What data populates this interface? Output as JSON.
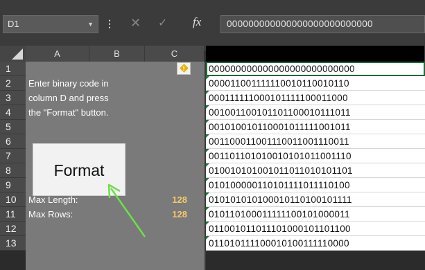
{
  "formula_bar": {
    "cell_ref": "D1",
    "cancel_icon": "close-icon",
    "enter_icon": "check-icon",
    "fx_label": "fx",
    "content": "000000000000000000000000000"
  },
  "columns": [
    "A",
    "B",
    "C",
    "D"
  ],
  "rows": [
    "1",
    "2",
    "3",
    "4",
    "5",
    "6",
    "7",
    "8",
    "9",
    "10",
    "11",
    "12",
    "13"
  ],
  "instructions": [
    "Enter binary code in",
    "column D and press",
    "the \"Format\" button."
  ],
  "format_button": {
    "label": "Format"
  },
  "settings": {
    "max_length_label": "Max Length:",
    "max_length_value": "128",
    "max_rows_label": "Max Rows:",
    "max_rows_value": "128"
  },
  "column_d": [
    "000000000000000000000000000",
    "000011001111110010110010110",
    "000111111000101111100011000",
    "001001100101101100010111011",
    "001010010110001011111001011",
    "001100011001110011001110011",
    "001101101010010101011001110",
    "010010101001011011010101101",
    "010100000110101111011110100",
    "010101010100010110100101111",
    "010110100011111100101000011",
    "011001011011101000101101100",
    "011010111100010100111110000"
  ],
  "colors": {
    "accent_value": "#f4c96b",
    "arrow": "#6ee04a",
    "selection": "#1d6b3a"
  }
}
